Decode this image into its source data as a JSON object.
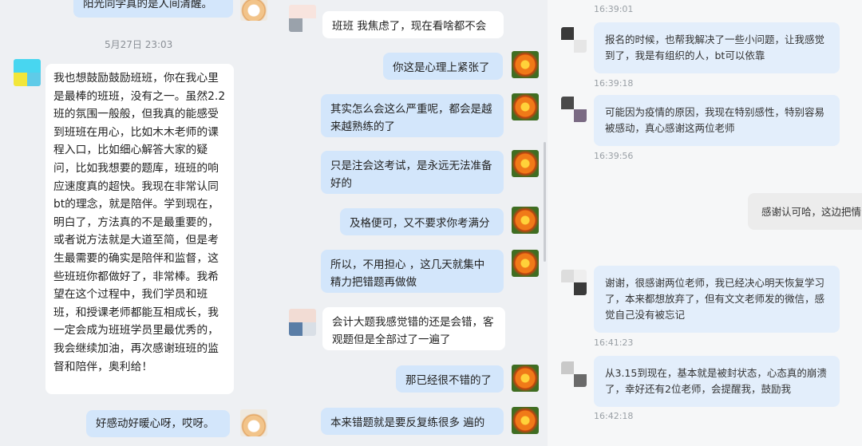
{
  "left_chat": {
    "top_message": "阳光同学真的是人间清醒。",
    "timestamp": "5月27日  23:03",
    "long_message": "我也想鼓励鼓励班班，你在我心里是最棒的班班，没有之一。虽然2.2班的氛围一般般，但我真的能感受到班班在用心，比如木木老师的课程入口，比如细心解答大家的疑问，比如我想要的题库，班班的响应速度真的超快。我现在非常认同bt的理念，就是陪伴。学到现在，明白了，方法真的不是最重要的，或者说方法就是大道至简，但是考生最需要的确实是陪伴和监督，这些班班你都做好了，非常棒。我希望在这个过程中，我们学员和班班，和授课老师都能互相成长，我一定会成为班班学员里最优秀的，我会继续加油，再次感谢班班的监督和陪伴，奥利给！",
    "reply": "好感动好暖心呀，哎呀。"
  },
  "middle_chat": {
    "messages": [
      {
        "side": "left",
        "text": "班班 我焦虑了，现在看啥都不会"
      },
      {
        "side": "right",
        "text": "你这是心理上紧张了"
      },
      {
        "side": "right",
        "text": "其实怎么会这么严重呢，都会是越来越熟练的了"
      },
      {
        "side": "right",
        "text": "只是注会这考试，是永远无法准备好的"
      },
      {
        "side": "right",
        "text": "及格便可，又不要求你考满分"
      },
      {
        "side": "right",
        "text": "所以，不用担心 ，这几天就集中精力把错题再做做"
      },
      {
        "side": "left",
        "text": "会计大题我感觉错的还是会错，客观题但是全部过了一遍了"
      },
      {
        "side": "right",
        "text": "那已经很不错的了"
      },
      {
        "side": "right",
        "text": "本来错题就是要反复练很多 遍的"
      }
    ]
  },
  "right_chat": {
    "top_ts": "16:39:01",
    "messages": [
      {
        "side": "left",
        "text": "报名的时候，也帮我解决了一些小问题，让我感觉到了，我是有组织的人，bt可以依靠",
        "time": "16:39:18"
      },
      {
        "side": "left",
        "text": "可能因为疫情的原因，我现在特别感性，特别容易被感动，真心感谢这两位老师",
        "time": "16:39:56"
      },
      {
        "side": "right",
        "text": "感谢认可哈，这边把情"
      },
      {
        "side": "left",
        "text": "谢谢，很感谢两位老师，我已经决心明天恢复学习了，本来都想放弃了，但有文文老师发的微信，感觉自己没有被忘记",
        "time": "16:41:23"
      },
      {
        "side": "left",
        "text": "从3.15到现在，基本就是被封状态，心态真的崩溃了，幸好还有2位老师，会提醒我，鼓励我",
        "time": "16:42:18"
      }
    ]
  },
  "colors": {
    "bubble_blue": "#d3e6fb",
    "bubble_white": "#ffffff",
    "panel_bg": "#eef0f3"
  }
}
